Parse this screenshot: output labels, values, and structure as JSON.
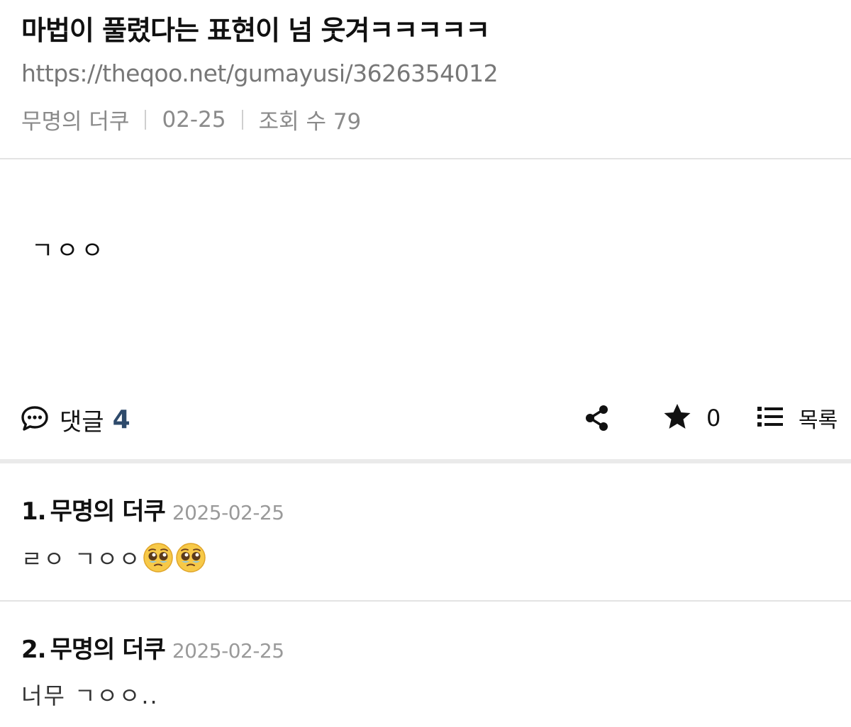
{
  "post": {
    "title": "마법이 풀렸다는 표현이 넘 웃겨ㅋㅋㅋㅋㅋ",
    "url": "https://theqoo.net/gumayusi/3626354012",
    "author": "무명의 더쿠",
    "date": "02-25",
    "views_label": "조회 수 79",
    "body": "ㄱㅇㅇ"
  },
  "actions": {
    "comment_label": "댓글",
    "comment_count": "4",
    "favorite_count": "0",
    "list_label": "목록",
    "icons": {
      "comment": "speech-bubble-icon",
      "share": "share-icon",
      "favorite": "star-icon",
      "list": "list-icon"
    }
  },
  "comments": [
    {
      "number": "1.",
      "author": "무명의 더쿠",
      "date": "2025-02-25",
      "text": "ㄹㅇ ㄱㅇㅇ",
      "emoji": "pleading-face 🥹🥹"
    },
    {
      "number": "2.",
      "author": "무명의 더쿠",
      "date": "2025-02-25",
      "text": "너무 ㄱㅇㅇ.."
    }
  ],
  "colors": {
    "accent_count": "#2e4a6b",
    "muted_text": "#8a8a8a",
    "divider": "#e3e3e3"
  }
}
